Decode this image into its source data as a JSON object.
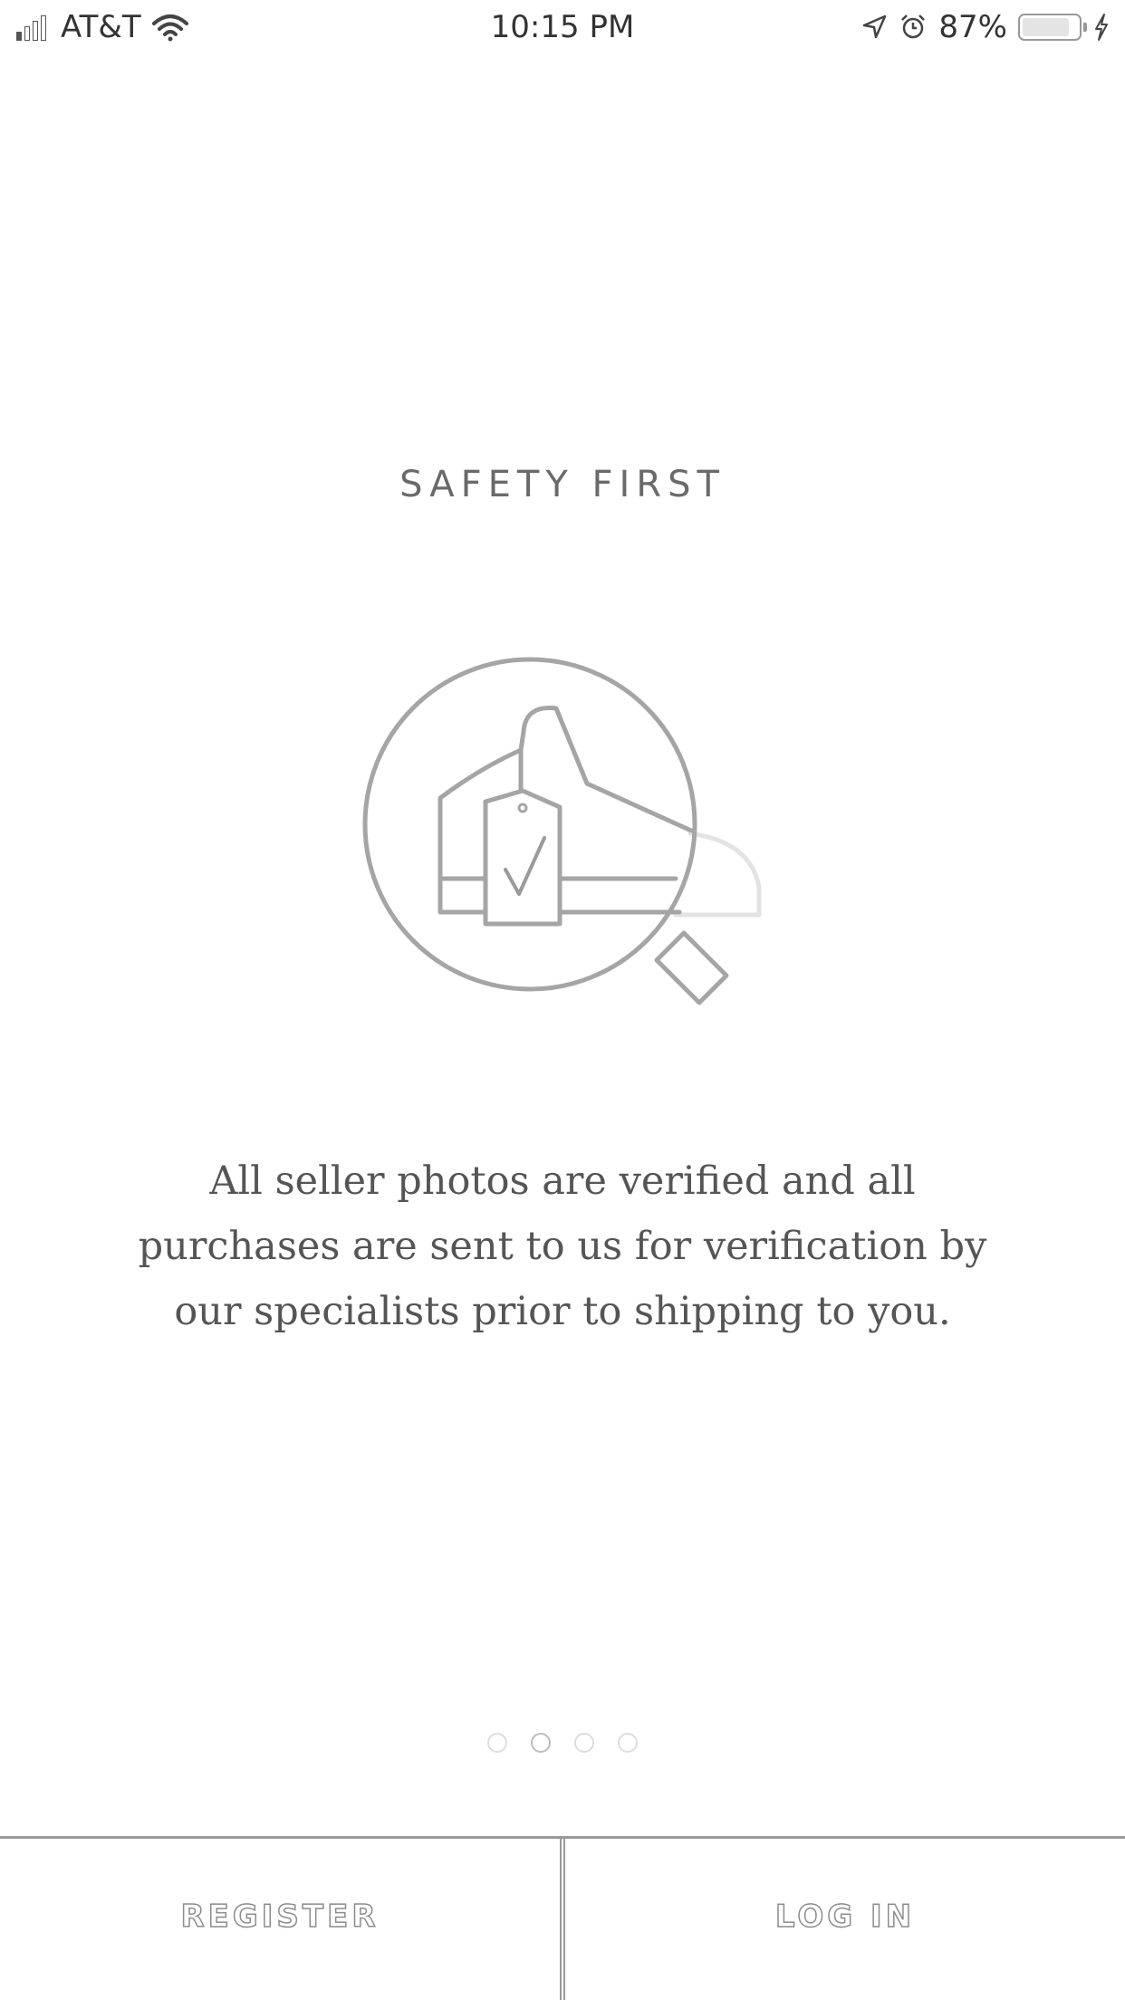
{
  "status_bar": {
    "carrier": "AT&T",
    "time": "10:15 PM",
    "battery_percent": "87%",
    "battery_level": 0.87,
    "icons": [
      "signal-icon",
      "wifi-icon",
      "location-icon",
      "alarm-icon",
      "battery-icon",
      "charging-icon"
    ]
  },
  "onboarding": {
    "title": "SAFETY FIRST",
    "illustration": "magnifier-sneaker-verified-tag-icon",
    "description": "All seller photos are verified and all purchases are sent to us for verification by our specialists prior to shipping to you.",
    "page_count": 4,
    "active_page": 2
  },
  "actions": {
    "register_label": "REGISTER",
    "login_label": "LOG IN"
  },
  "colors": {
    "line_gray": "#9a9a9a",
    "text_gray": "#555555",
    "background": "#ffffff"
  }
}
